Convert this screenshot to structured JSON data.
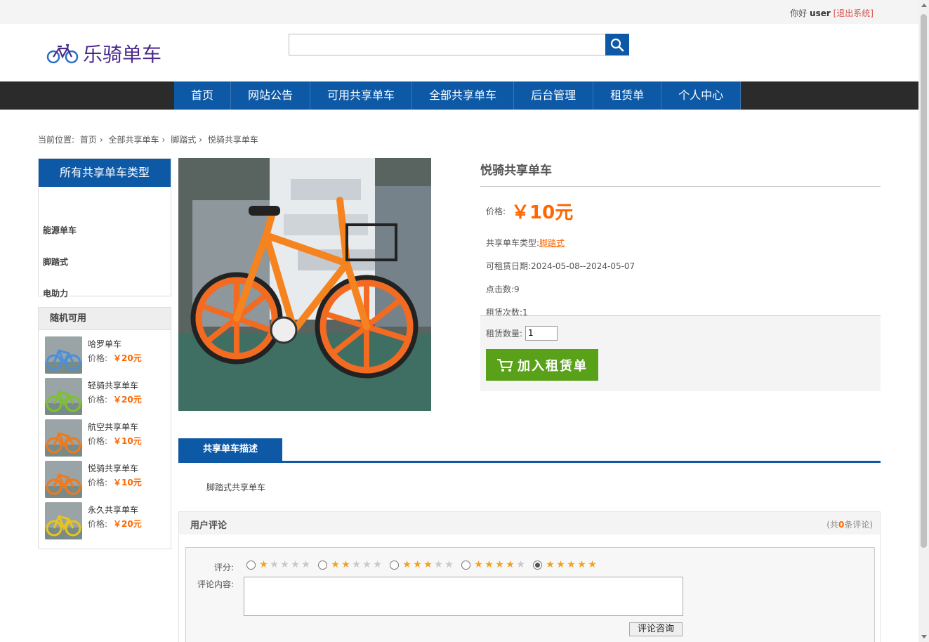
{
  "topbar": {
    "greeting": "你好",
    "username": "user",
    "logout": "[退出系统]"
  },
  "header": {
    "logo_text": "乐骑单车",
    "search_placeholder": ""
  },
  "nav": {
    "items": [
      "首页",
      "网站公告",
      "可用共享单车",
      "全部共享单车",
      "后台管理",
      "租赁单",
      "个人中心"
    ]
  },
  "breadcrumb": {
    "prefix": "当前位置:",
    "items": [
      "首页",
      "全部共享单车",
      "脚踏式",
      "悦骑共享单车"
    ]
  },
  "sidebar": {
    "types_title": "所有共享单车类型",
    "types": [
      "能源单车",
      "脚踏式",
      "电助力"
    ],
    "random_title": "随机可用",
    "price_label": "价格:",
    "random": [
      {
        "name": "哈罗单车",
        "price": "￥20元",
        "color": "#4a90d9"
      },
      {
        "name": "轻骑共享单车",
        "price": "￥20元",
        "color": "#7cc22e"
      },
      {
        "name": "航空共享单车",
        "price": "￥10元",
        "color": "#f07a1a"
      },
      {
        "name": "悦骑共享单车",
        "price": "￥10元",
        "color": "#f07a1a"
      },
      {
        "name": "永久共享单车",
        "price": "￥20元",
        "color": "#e8c51c"
      }
    ]
  },
  "product": {
    "title": "悦骑共享单车",
    "price_label": "价格:",
    "price": "￥10元",
    "type_label": "共享单车类型:",
    "type_value": "脚踏式",
    "date_label": "可租赁日期:",
    "date_value": "2024-05-08--2024-05-07",
    "clicks_label": "点击数:",
    "clicks_value": "9",
    "rents_label": "租赁次数:",
    "rents_value": "1",
    "qty_label": "租赁数量:",
    "qty_value": "1",
    "add_button": "加入租赁单"
  },
  "tabs": {
    "active": "共享单车描述"
  },
  "description": "脚踏式共享单车",
  "comments": {
    "title": "用户评论",
    "count_prefix": "(共",
    "count": "0",
    "count_suffix": "条评论)",
    "rating_label": "评分:",
    "ratings": [
      1,
      2,
      3,
      4,
      5
    ],
    "selected_rating": 5,
    "content_label": "评论内容:",
    "submit": "评论咨询"
  },
  "colors": {
    "brand_blue": "#0d59a6",
    "price_orange": "#ff6600",
    "buy_green": "#5aa11a"
  }
}
